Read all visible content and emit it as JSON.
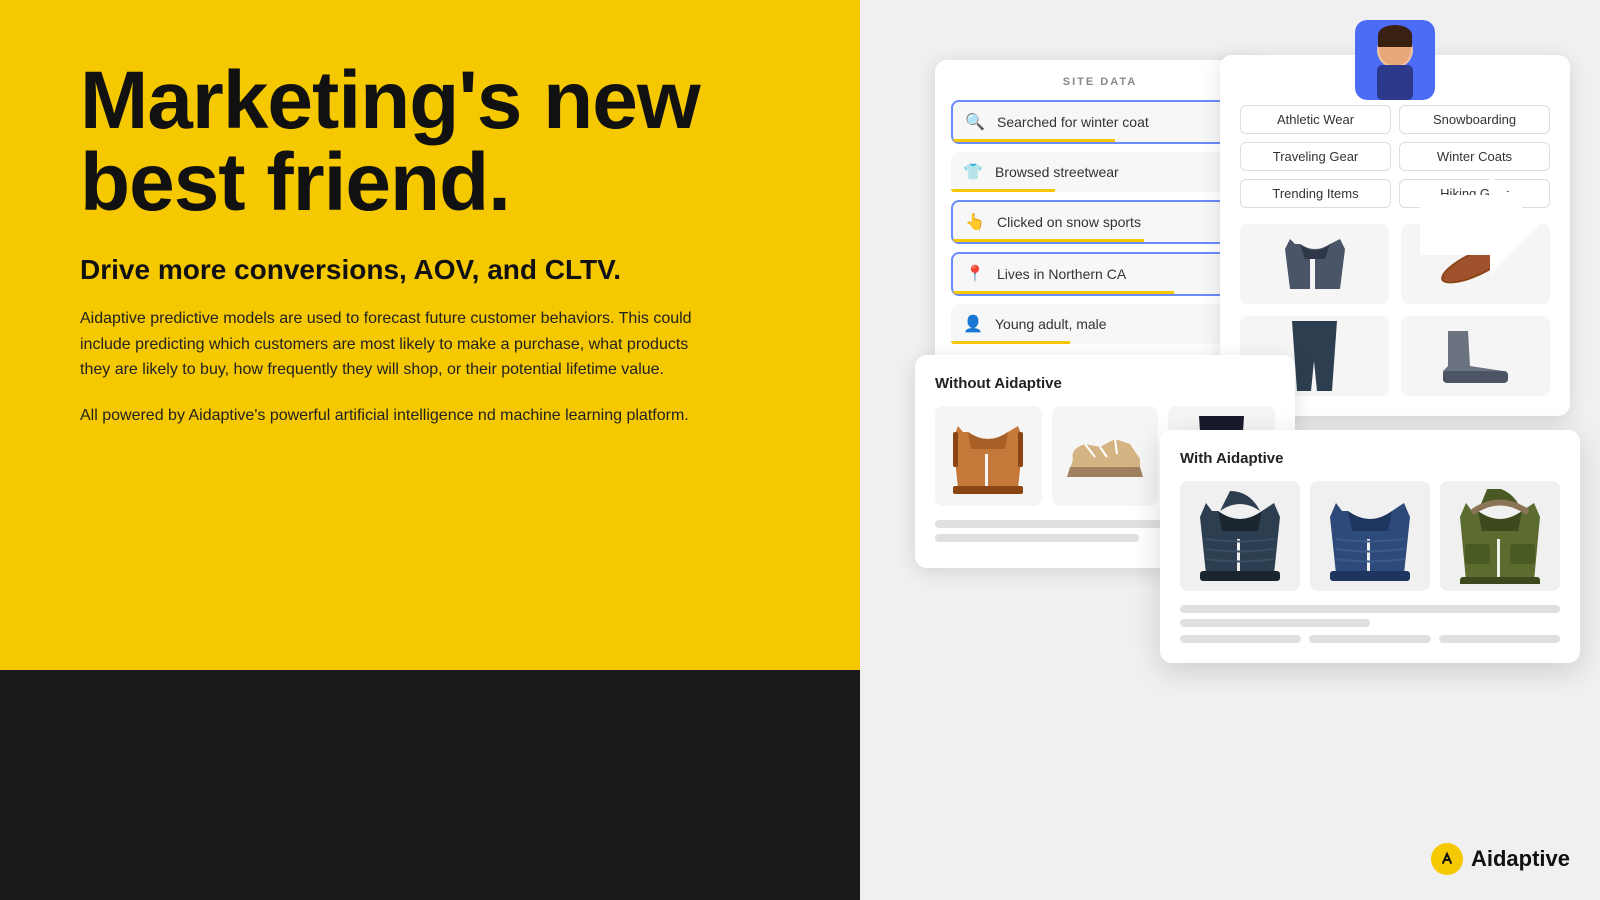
{
  "left": {
    "headline": "Marketing's new best friend.",
    "subheadline": "Drive more conversions, AOV, and CLTV.",
    "body1": "Aidaptive predictive models are used to forecast future customer behaviors. This could include predicting which customers are most likely to make a purchase, what products they are likely to buy, how frequently they will shop, or their potential lifetime value.",
    "body2": "All powered by Aidaptive's powerful artificial intelligence nd machine learning platform."
  },
  "site_data": {
    "label": "SITE DATA",
    "items": [
      {
        "icon": "🔍",
        "text": "Searched for winter coat",
        "active": true
      },
      {
        "icon": "👕",
        "text": "Browsed streetwear",
        "active": false
      },
      {
        "icon": "👆",
        "text": "Clicked on snow sports",
        "active": true
      },
      {
        "icon": "📍",
        "text": "Lives in Northern CA",
        "active": true
      },
      {
        "icon": "👤",
        "text": "Young adult, male",
        "active": false
      }
    ]
  },
  "user_profile": {
    "tags": [
      "Athletic Wear",
      "Snowboarding",
      "Traveling Gear",
      "Winter Coats",
      "Trending Items",
      "Hiking Gear"
    ]
  },
  "without_panel": {
    "title": "Without Aidaptive"
  },
  "with_panel": {
    "title": "With Aidaptive"
  },
  "logo": {
    "text": "Aidaptive"
  }
}
